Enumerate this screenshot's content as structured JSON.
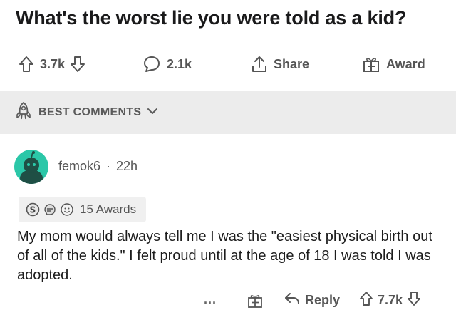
{
  "post": {
    "title": "What's the worst lie you were told as a kid?"
  },
  "action_bar": {
    "upvotes": "3.7k",
    "comments": "2.1k",
    "share_label": "Share",
    "award_label": "Award"
  },
  "sort": {
    "label": "BEST COMMENTS"
  },
  "comment": {
    "author": "femok6",
    "separator": "·",
    "time": "22h",
    "awards_label": "15 Awards",
    "body": "My mom would always tell me I was the \"easiest physical birth out of all of the kids.\" I felt proud until at the age of 18 I was told I was adopted.",
    "more_label": "...",
    "reply_label": "Reply",
    "votes": "7.7k"
  },
  "colors": {
    "avatar": "#2bc7a8",
    "sort_bar_bg": "#ececec",
    "muted_text": "#555555"
  },
  "icons": [
    "upvote-icon",
    "downvote-icon",
    "comment-icon",
    "share-icon",
    "gift-icon",
    "rocket-icon",
    "chevron-down-icon",
    "silver-award-icon",
    "helpful-award-icon",
    "wholesome-award-icon",
    "reply-icon"
  ]
}
